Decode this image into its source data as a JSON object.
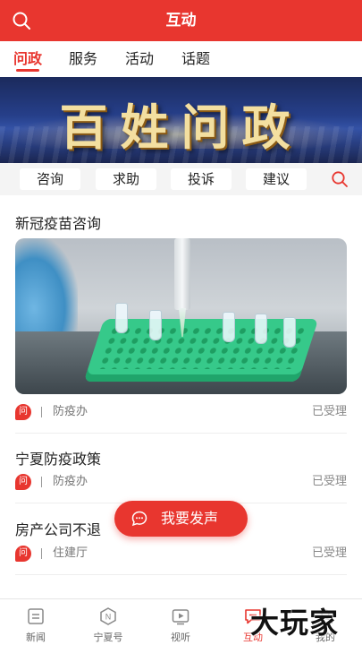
{
  "header": {
    "title": "互动",
    "search_icon": "search-icon"
  },
  "tabs": [
    {
      "label": "问政",
      "active": true
    },
    {
      "label": "服务"
    },
    {
      "label": "活动"
    },
    {
      "label": "话题"
    }
  ],
  "banner": {
    "text": "百姓问政"
  },
  "categories": [
    {
      "label": "咨询"
    },
    {
      "label": "求助"
    },
    {
      "label": "投诉"
    },
    {
      "label": "建议"
    }
  ],
  "posts": [
    {
      "title": "新冠疫苗咨询",
      "badge": "问",
      "dept": "防疫办",
      "status": "已受理"
    },
    {
      "title": "宁夏防疫政策",
      "badge": "问",
      "dept": "防疫办",
      "status": "已受理"
    },
    {
      "title": "房产公司不退",
      "badge": "问",
      "dept": "住建厅",
      "status": "已受理"
    }
  ],
  "fab": {
    "label": "我要发声"
  },
  "bottom_nav": [
    {
      "label": "新闻",
      "icon": "news-icon"
    },
    {
      "label": "宁夏号",
      "icon": "ningxia-hao-icon"
    },
    {
      "label": "视听",
      "icon": "video-icon"
    },
    {
      "label": "互动",
      "icon": "interact-icon",
      "active": true
    },
    {
      "label": "我的",
      "icon": "profile-icon"
    }
  ],
  "watermark": "大玩家",
  "colors": {
    "accent": "#e8362f",
    "tab_bar_bg": "#f4f4f4"
  }
}
